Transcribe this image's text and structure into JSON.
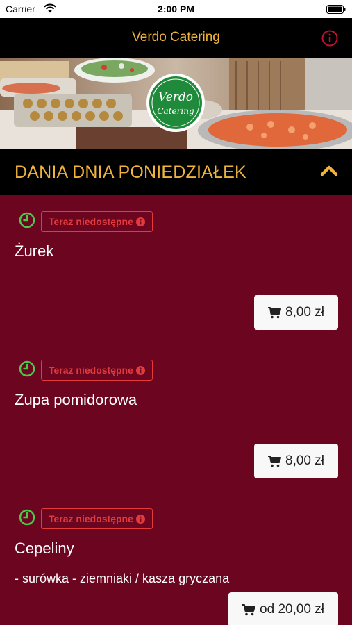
{
  "status_bar": {
    "carrier": "Carrier",
    "time": "2:00 PM"
  },
  "navbar": {
    "title": "Verdo Catering",
    "info_icon": "info-circle-icon"
  },
  "banner": {
    "logo_line1": "Verdo",
    "logo_line2": "Catering"
  },
  "section": {
    "title": "DANIA DNIA PONIEDZIAŁEK",
    "icon": "chevron-up-icon"
  },
  "items": [
    {
      "badge": "Teraz niedostępne",
      "name": "Żurek",
      "description": "",
      "price": "8,00 zł"
    },
    {
      "badge": "Teraz niedostępne",
      "name": "Zupa pomidorowa",
      "description": "",
      "price": "8,00 zł"
    },
    {
      "badge": "Teraz niedostępne",
      "name": "Cepeliny",
      "description": "- surówka - ziemniaki / kasza gryczana",
      "price": "od 20,00 zł"
    }
  ],
  "colors": {
    "accent": "#f0b33c",
    "background": "#6b0520",
    "alert": "#e33a3a",
    "clock": "#4cc84c"
  }
}
